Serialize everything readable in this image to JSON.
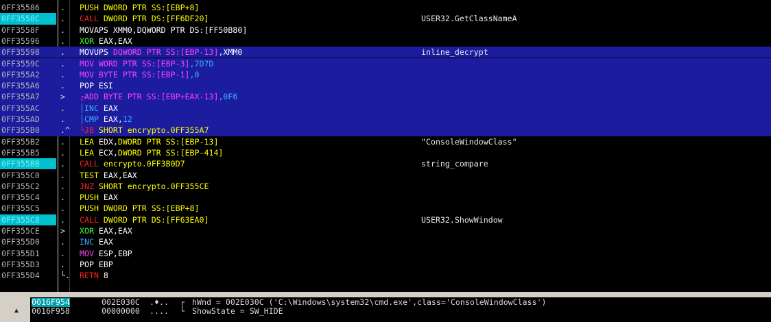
{
  "disasm": [
    {
      "addr": "0FF35586",
      "marker": ".",
      "ins": [
        [
          "PUSH ",
          "c-y"
        ],
        [
          "DWORD PTR SS:[EBP+8]",
          "c-y"
        ]
      ],
      "comment": ""
    },
    {
      "addr": "0FF3558C",
      "addr_style": "cyan",
      "marker": ".",
      "ins": [
        [
          "CALL ",
          "c-r"
        ],
        [
          "DWORD PTR DS:[FF6DF20]",
          "c-y"
        ]
      ],
      "comment": "USER32.GetClassNameA"
    },
    {
      "addr": "0FF3558F",
      "marker": ".",
      "ins": [
        [
          "MOVAPS XMM0,DQWORD PTR DS:[FF50B80]",
          "c-w"
        ]
      ],
      "comment": ""
    },
    {
      "addr": "0FF35596",
      "marker": ".",
      "ins": [
        [
          "XOR ",
          "c-g"
        ],
        [
          "EAX,EAX",
          "c-w"
        ]
      ],
      "comment": ""
    },
    {
      "addr": "0FF35598",
      "hl": true,
      "marker": ".",
      "ins": [
        [
          "MOVUPS ",
          "c-w"
        ],
        [
          "DQWORD PTR SS:[EBP-13]",
          "c-m"
        ],
        [
          ",XMM0",
          "c-w"
        ]
      ],
      "comment": "inline_decrypt"
    },
    {
      "addr": "0FF3559C",
      "hl": true,
      "marker": ".",
      "ins": [
        [
          "MOV ",
          "c-m"
        ],
        [
          "WORD PTR SS:[EBP-3]",
          "c-m"
        ],
        [
          ",7D7D",
          "c-b"
        ]
      ],
      "comment": ""
    },
    {
      "addr": "0FF355A2",
      "hl": true,
      "marker": ".",
      "ins": [
        [
          "MOV ",
          "c-m"
        ],
        [
          "BYTE PTR SS:[EBP-1]",
          "c-m"
        ],
        [
          ",0",
          "c-b"
        ]
      ],
      "comment": ""
    },
    {
      "addr": "0FF355A6",
      "hl": true,
      "marker": ".",
      "ins": [
        [
          "POP ",
          "c-w"
        ],
        [
          "ESI",
          "c-w"
        ]
      ],
      "comment": ""
    },
    {
      "addr": "0FF355A7",
      "hl": true,
      "marker": ">",
      "ins": [
        [
          "┌ADD ",
          "c-m"
        ],
        [
          "BYTE PTR SS:[EBP+EAX-13]",
          "c-m"
        ],
        [
          ",0F6",
          "c-b"
        ]
      ],
      "comment": ""
    },
    {
      "addr": "0FF355AC",
      "hl": true,
      "marker": ".",
      "ins": [
        [
          "│INC ",
          "c-b"
        ],
        [
          "EAX",
          "c-w"
        ]
      ],
      "comment": ""
    },
    {
      "addr": "0FF355AD",
      "hl": true,
      "marker": ".",
      "ins": [
        [
          "│CMP ",
          "c-b"
        ],
        [
          "EAX,",
          "c-w"
        ],
        [
          "12",
          "c-b"
        ]
      ],
      "comment": ""
    },
    {
      "addr": "0FF355B0",
      "hl": true,
      "marker": ".^",
      "ins": [
        [
          "└JB ",
          "c-r"
        ],
        [
          "SHORT encrypto.0FF355A7",
          "c-y"
        ]
      ],
      "comment": ""
    },
    {
      "addr": "0FF355B2",
      "marker": ".",
      "ins": [
        [
          "LEA ",
          "c-y"
        ],
        [
          "EDX,",
          "c-w"
        ],
        [
          "DWORD PTR SS:[EBP-13]",
          "c-y"
        ]
      ],
      "comment": "\"ConsoleWindowClass\""
    },
    {
      "addr": "0FF355B5",
      "marker": ".",
      "ins": [
        [
          "LEA ",
          "c-y"
        ],
        [
          "ECX,",
          "c-w"
        ],
        [
          "DWORD PTR SS:[EBP-414]",
          "c-y"
        ]
      ],
      "comment": ""
    },
    {
      "addr": "0FF355BB",
      "addr_style": "cyan",
      "marker": ".",
      "ins": [
        [
          "CALL ",
          "c-r"
        ],
        [
          "encrypto.0FF3B0D7",
          "c-y"
        ]
      ],
      "comment": "string_compare"
    },
    {
      "addr": "0FF355C0",
      "marker": ".",
      "ins": [
        [
          "TEST ",
          "c-y"
        ],
        [
          "EAX,EAX",
          "c-w"
        ]
      ],
      "comment": ""
    },
    {
      "addr": "0FF355C2",
      "marker": ".",
      "ins": [
        [
          "JNZ ",
          "c-r"
        ],
        [
          "SHORT encrypto.0FF355CE",
          "c-y"
        ]
      ],
      "comment": ""
    },
    {
      "addr": "0FF355C4",
      "marker": ".",
      "ins": [
        [
          "PUSH ",
          "c-y"
        ],
        [
          "EAX",
          "c-w"
        ]
      ],
      "comment": ""
    },
    {
      "addr": "0FF355C5",
      "marker": ".",
      "ins": [
        [
          "PUSH ",
          "c-y"
        ],
        [
          "DWORD PTR SS:[EBP+8]",
          "c-y"
        ]
      ],
      "comment": ""
    },
    {
      "addr": "0FF355C8",
      "addr_style": "cyan",
      "marker": ".",
      "ins": [
        [
          "CALL ",
          "c-r"
        ],
        [
          "DWORD PTR DS:[FF63EA0]",
          "c-y"
        ]
      ],
      "comment": "USER32.ShowWindow"
    },
    {
      "addr": "0FF355CE",
      "marker": ">",
      "ins": [
        [
          "XOR ",
          "c-g"
        ],
        [
          "EAX,EAX",
          "c-w"
        ]
      ],
      "comment": ""
    },
    {
      "addr": "0FF355D0",
      "marker": ".",
      "ins": [
        [
          "INC ",
          "c-b"
        ],
        [
          "EAX",
          "c-w"
        ]
      ],
      "comment": ""
    },
    {
      "addr": "0FF355D1",
      "marker": ".",
      "ins": [
        [
          "MOV ",
          "c-m"
        ],
        [
          "ESP,EBP",
          "c-w"
        ]
      ],
      "comment": ""
    },
    {
      "addr": "0FF355D3",
      "marker": ".",
      "ins": [
        [
          "POP ",
          "c-w"
        ],
        [
          "EBP",
          "c-w"
        ]
      ],
      "comment": ""
    },
    {
      "addr": "0FF355D4",
      "marker": "└.",
      "ins": [
        [
          "RETN ",
          "c-r"
        ],
        [
          "8",
          "c-w"
        ]
      ],
      "comment": ""
    }
  ],
  "stack": [
    {
      "addr": "0016F954",
      "selected": true,
      "value": "002E030C",
      "ascii": ".♦..",
      "bracket": "┌",
      "comment": "hWnd = 002E030C ('C:\\Windows\\system32\\cmd.exe',class='ConsoleWindowClass')"
    },
    {
      "addr": "0016F958",
      "selected": false,
      "value": "00000000",
      "ascii": "....",
      "bracket": "└",
      "comment": "ShowState = SW_HIDE"
    }
  ],
  "icons": {
    "scroll_up": "scroll-up-arrow-icon"
  }
}
